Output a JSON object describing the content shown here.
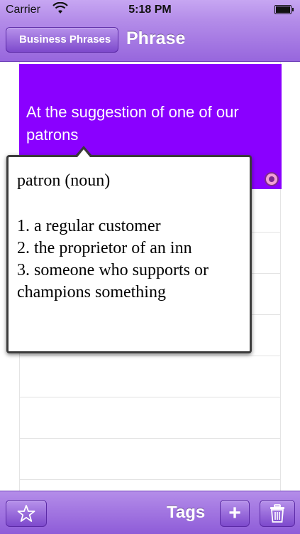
{
  "status_bar": {
    "carrier": "Carrier",
    "time": "5:18 PM",
    "icons": [
      "wifi-icon",
      "battery-icon"
    ]
  },
  "nav_bar": {
    "back_label": "Business Phrases",
    "title": "Phrase"
  },
  "phrase": {
    "text": "At the suggestion of one of our patrons",
    "card_color": "#8a00ff",
    "sound_icon": "sound-icon"
  },
  "definition_popup": {
    "word": "patron (noun)",
    "definitions": [
      "1. a regular customer",
      "2. the proprietor of an inn",
      "3. someone who supports or champions something"
    ]
  },
  "toolbar": {
    "star_icon": "star-icon",
    "tags_label": "Tags",
    "add_label": "+",
    "trash_icon": "trash-icon"
  },
  "colors": {
    "accent": "#9766dd",
    "card": "#8a00ff"
  }
}
